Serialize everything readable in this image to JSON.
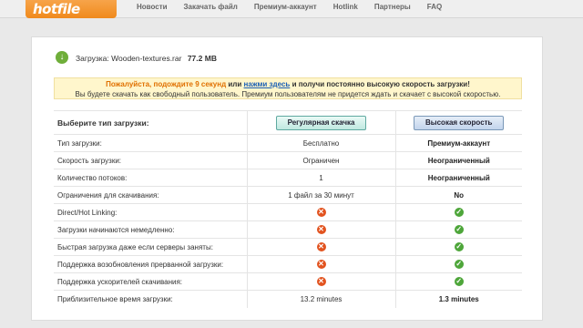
{
  "logo": "hotfile",
  "nav": [
    "Новости",
    "Закачать файл",
    "Премиум-аккаунт",
    "Hotlink",
    "Партнеры",
    "FAQ"
  ],
  "download": {
    "prefix": "Загрузка:",
    "filename": "Wooden-textures.rar",
    "size": "77.2 MB"
  },
  "notice": {
    "wait": "Пожалуйста, подождите 9 секунд",
    "or": "или",
    "link": "нажми здесь",
    "rest": "и получи постоянно высокую скорость загрузки!",
    "line2": "Вы будете скачать как свободный пользователь. Премиум пользователям не придется ждать и скачает с высокой скоростью."
  },
  "table": {
    "header": "Выберите тип загрузки:",
    "free_button": "Регулярная скачка",
    "premium_button": "Высокая скорость",
    "rows": [
      {
        "label": "Тип загрузки:",
        "free": "Бесплатно",
        "premium": "Премиум-аккаунт"
      },
      {
        "label": "Скорость загрузки:",
        "free": "Ограничен",
        "premium": "Неограниченный"
      },
      {
        "label": "Количество потоков:",
        "free": "1",
        "premium": "Неограниченный"
      },
      {
        "label": "Ограничения для скачивания:",
        "free": "1 файл за 30 минут",
        "premium": "No"
      },
      {
        "label": "Direct/Hot Linking:",
        "free": "x",
        "premium": "ok"
      },
      {
        "label": "Загрузки начинаются немедленно:",
        "free": "x",
        "premium": "ok"
      },
      {
        "label": "Быстрая загрузка даже если серверы заняты:",
        "free": "x",
        "premium": "ok"
      },
      {
        "label": "Поддержка возобновления прерванной загрузки:",
        "free": "x",
        "premium": "ok"
      },
      {
        "label": "Поддержка ускорителей скачивания:",
        "free": "x",
        "premium": "ok"
      },
      {
        "label": "Приблизительное время загрузки:",
        "free": "13.2 minutes",
        "premium": "1.3 minutes"
      }
    ]
  }
}
